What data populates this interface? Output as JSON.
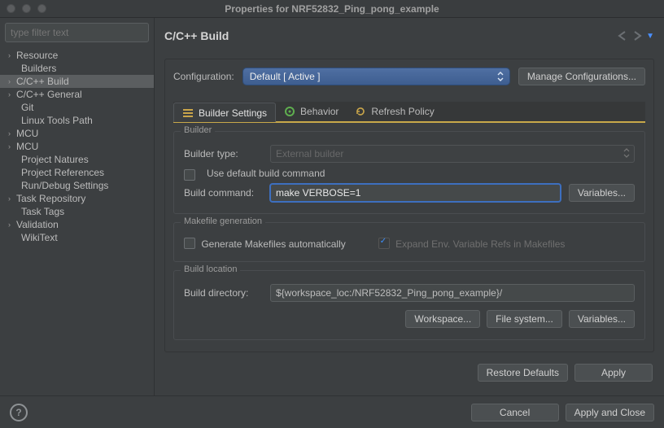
{
  "window": {
    "title": "Properties for NRF52832_Ping_pong_example"
  },
  "sidebar": {
    "filter_placeholder": "type filter text",
    "items": [
      {
        "label": "Resource",
        "expandable": true
      },
      {
        "label": "Builders",
        "expandable": false
      },
      {
        "label": "C/C++ Build",
        "expandable": true,
        "selected": true
      },
      {
        "label": "C/C++ General",
        "expandable": true
      },
      {
        "label": "Git",
        "expandable": false
      },
      {
        "label": "Linux Tools Path",
        "expandable": false
      },
      {
        "label": "MCU",
        "expandable": true
      },
      {
        "label": "MCU",
        "expandable": true
      },
      {
        "label": "Project Natures",
        "expandable": false
      },
      {
        "label": "Project References",
        "expandable": false
      },
      {
        "label": "Run/Debug Settings",
        "expandable": false
      },
      {
        "label": "Task Repository",
        "expandable": true
      },
      {
        "label": "Task Tags",
        "expandable": false
      },
      {
        "label": "Validation",
        "expandable": true
      },
      {
        "label": "WikiText",
        "expandable": false
      }
    ]
  },
  "main": {
    "heading": "C/C++ Build",
    "config_label": "Configuration:",
    "config_value": "Default  [ Active ]",
    "manage_config": "Manage Configurations...",
    "tabs": [
      {
        "label": "Builder Settings",
        "active": true,
        "icon": "list-icon"
      },
      {
        "label": "Behavior",
        "active": false,
        "icon": "gear-green-icon"
      },
      {
        "label": "Refresh Policy",
        "active": false,
        "icon": "refresh-icon"
      }
    ],
    "builder": {
      "legend": "Builder",
      "type_label": "Builder type:",
      "type_value": "External builder",
      "use_default_label": "Use default build command",
      "command_label": "Build command:",
      "command_value": "make VERBOSE=1",
      "variables_btn": "Variables..."
    },
    "makefile": {
      "legend": "Makefile generation",
      "generate_label": "Generate Makefiles automatically",
      "expand_label": "Expand Env. Variable Refs in Makefiles"
    },
    "location": {
      "legend": "Build location",
      "dir_label": "Build directory:",
      "dir_value": "${workspace_loc:/NRF52832_Ping_pong_example}/",
      "workspace_btn": "Workspace...",
      "filesystem_btn": "File system...",
      "variables_btn": "Variables..."
    },
    "restore_defaults": "Restore Defaults",
    "apply": "Apply"
  },
  "footer": {
    "cancel": "Cancel",
    "apply_close": "Apply and Close"
  }
}
